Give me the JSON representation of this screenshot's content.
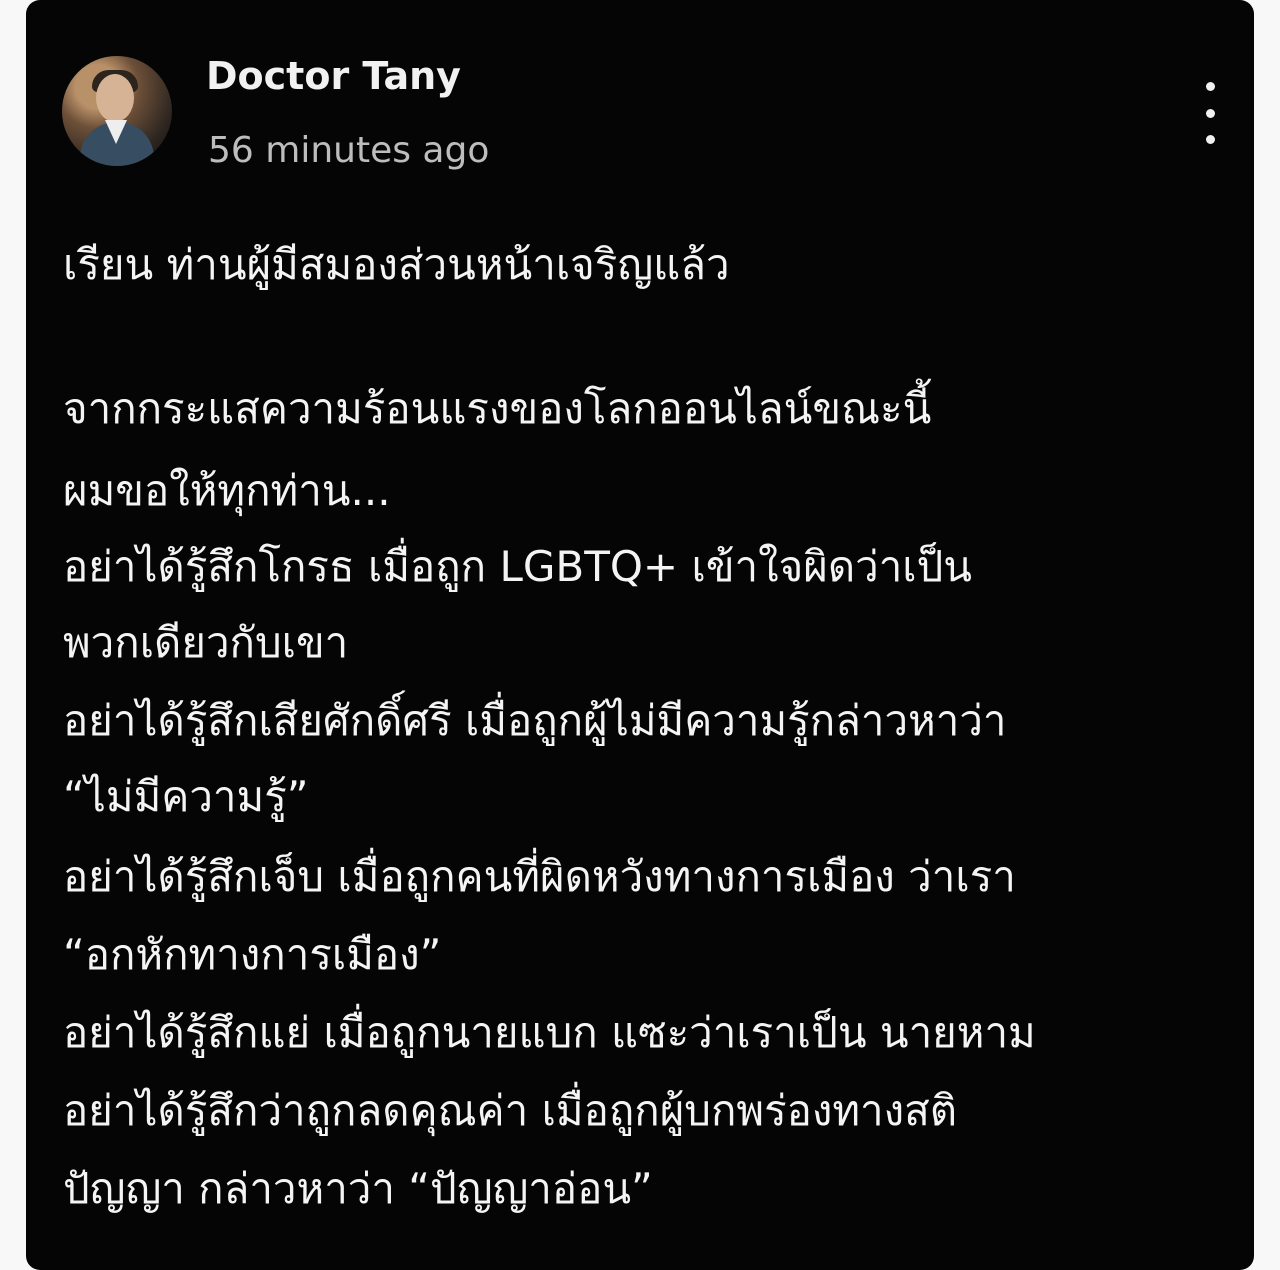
{
  "post": {
    "author_name": "Doctor Tany",
    "time_posted": "56 minutes ago",
    "more_menu_icon": "vertical-ellipsis-icon",
    "content_lines": [
      "เรียน ท่านผู้มีสมองส่วนหน้าเจริญแล้ว",
      "จากกระแสความร้อนแรงของโลกออนไลน์ขณะนี้",
      "ผมขอให้ทุกท่าน...",
      "อย่าได้รู้สึกโกรธ เมื่อถูก LGBTQ+ เข้าใจผิดว่าเป็น",
      "พวกเดียวกับเขา",
      "อย่าได้รู้สึกเสียศักดิ์ศรี เมื่อถูกผู้ไม่มีความรู้กล่าวหาว่า",
      "“ไม่มีความรู้”",
      "อย่าได้รู้สึกเจ็บ เมื่อถูกคนที่ผิดหวังทางการเมือง ว่าเรา",
      "“อกหักทางการเมือง”",
      "อย่าได้รู้สึกแย่ เมื่อถูกนายแบก แซะว่าเราเป็น นายหาม",
      "อย่าได้รู้สึกว่าถูกลดคุณค่า เมื่อถูกผู้บกพร่องทางสติ",
      "ปัญญา กล่าวหาว่า “ปัญญาอ่อน”"
    ]
  },
  "colors": {
    "card_background": "#050505",
    "outer_background": "#f8f8f8",
    "primary_text": "#f4f4f4",
    "secondary_text": "#bdbdbd"
  }
}
